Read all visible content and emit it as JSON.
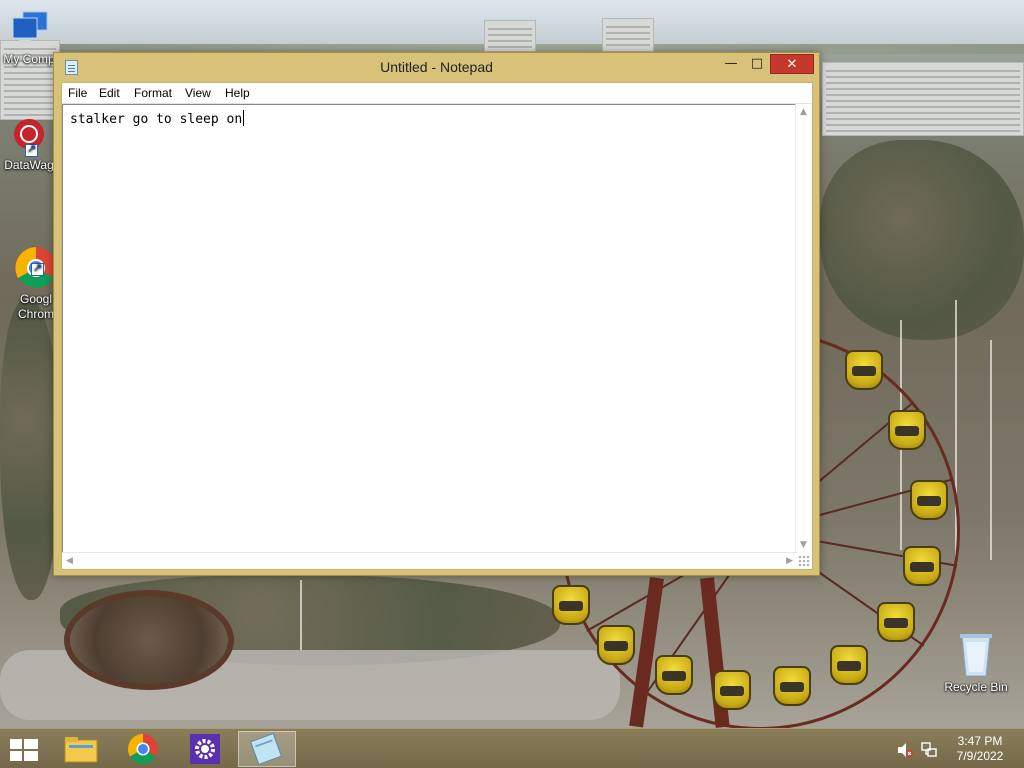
{
  "desktop": {
    "icons": [
      {
        "label": "My Comp",
        "icon": "computer-icon"
      },
      {
        "label": "DataWag",
        "icon": "datawag-icon"
      },
      {
        "label": "Googl\nChrom",
        "icon": "chrome-icon"
      },
      {
        "label": "Recycle Bin",
        "icon": "recycle-bin-icon"
      }
    ]
  },
  "window": {
    "title": "Untitled - Notepad",
    "controls": {
      "minimize": "—",
      "maximize": "□",
      "close": "✕"
    },
    "menu": [
      "File",
      "Edit",
      "Format",
      "View",
      "Help"
    ],
    "editor_text": "stalker go to sleep on"
  },
  "taskbar": {
    "pinned": [
      {
        "name": "file-explorer",
        "icon": "folder-icon"
      },
      {
        "name": "google-chrome",
        "icon": "chrome-icon"
      },
      {
        "name": "settings",
        "icon": "gear-icon"
      },
      {
        "name": "notepad",
        "icon": "notepad-icon",
        "active": true
      }
    ],
    "tray": {
      "volume_icon": "volume-muted-icon",
      "network_icon": "network-icon",
      "time": "3:47 PM",
      "date": "7/9/2022"
    }
  },
  "colors": {
    "window_frame": "#d8c27a",
    "close_button": "#c7382c",
    "taskbar": "#7f7352"
  }
}
